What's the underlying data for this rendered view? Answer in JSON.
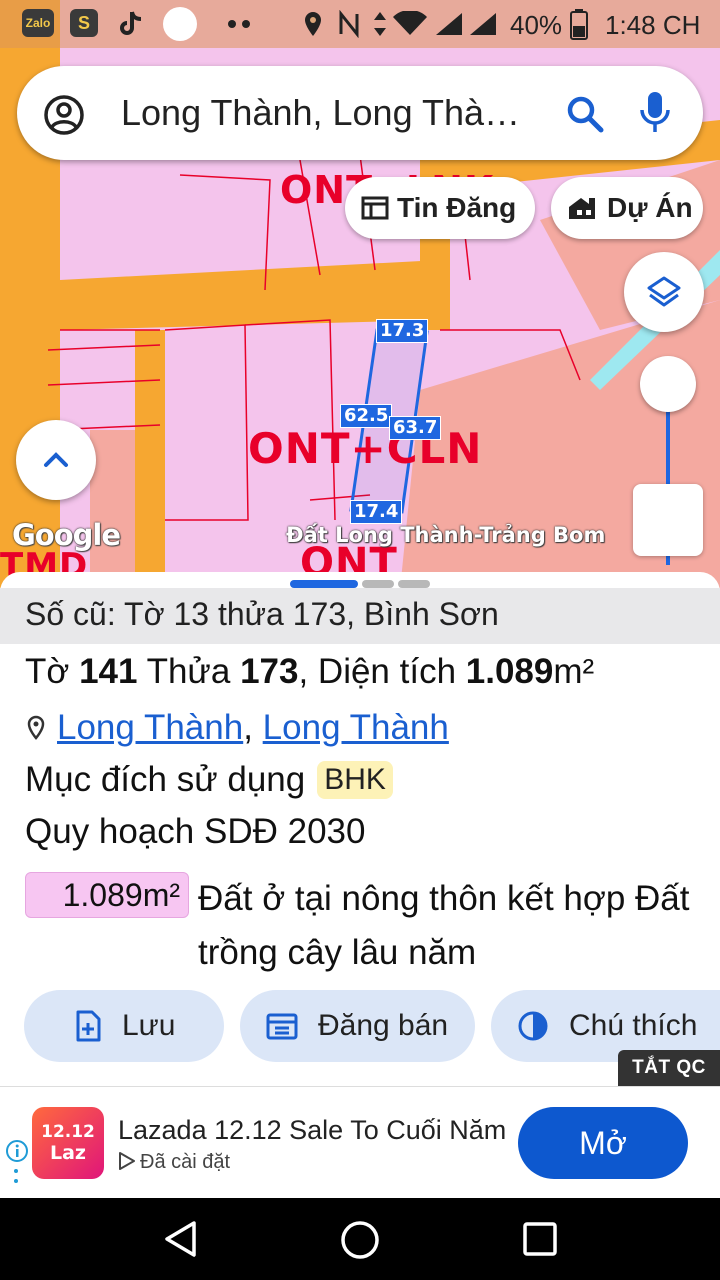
{
  "status_bar": {
    "app_zalo": "Zalo",
    "app_shopee": "S",
    "battery": "40%",
    "time": "1:48 CH"
  },
  "search": {
    "value": "Long Thành, Long Thà…"
  },
  "chips": {
    "tin_dang": "Tin Đăng",
    "du_an": "Dự Án"
  },
  "map": {
    "zone_top": "ONT+LNK",
    "zone_main": "ONT+CLN",
    "zone_bottom": "ONT",
    "zone_left": "TMD",
    "dim_top": "17.3",
    "dim_left": "62.5",
    "dim_right": "63.7",
    "dim_bottom": "17.4",
    "google_logo": "Google",
    "caption": "Đất Long Thành-Trảng Bom"
  },
  "parcel": {
    "old_info": "Số cũ: Tờ 13 thửa 173, Bình Sơn",
    "to_label": "Tờ",
    "to_value": "141",
    "thua_label": "Thửa",
    "thua_value": "173",
    "dien_tich_label": ", Diện tích",
    "area_value": "1.089",
    "area_unit": "m²",
    "location_1": "Long Thành",
    "location_sep": ",",
    "location_2": "Long Thành",
    "purpose_label": "Mục đích sử dụng",
    "purpose_code": "BHK",
    "planning_label": "Quy hoạch SDĐ 2030",
    "planning_area": "1.089m²",
    "planning_desc": "Đất ở tại nông thôn kết hợp Đất trồng cây lâu năm"
  },
  "actions": {
    "save": "Lưu",
    "post_sale": "Đăng bán",
    "legend": "Chú thích"
  },
  "ad": {
    "close_label": "TẮT QC",
    "logo_top": "12.12",
    "logo_bottom": "Laz",
    "title": "Lazada 12.12 Sale To Cuối Năm",
    "subtitle": "Đã cài đặt",
    "open_label": "Mở"
  },
  "colors": {
    "accent": "#1a5fd0",
    "open_button": "#0d58cf",
    "zone_pink": "#f4c4ec",
    "road_orange": "#f6a731",
    "zone_text_red": "#e8002a",
    "plot_blue": "#1f67e0"
  }
}
